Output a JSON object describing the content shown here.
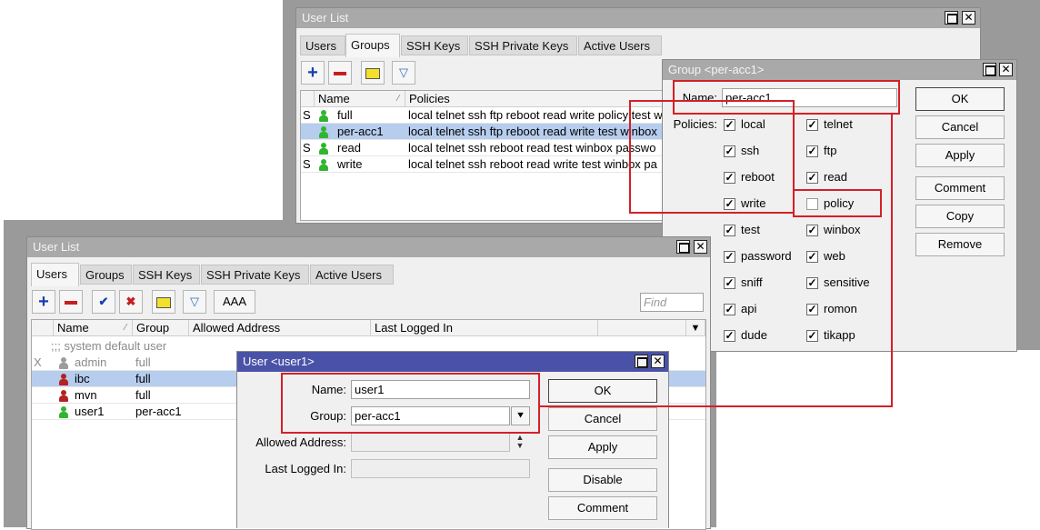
{
  "win_top": {
    "title": "User List",
    "tabs": [
      "Users",
      "Groups",
      "SSH Keys",
      "SSH Private Keys",
      "Active Users"
    ],
    "columns": {
      "name": "Name",
      "policies": "Policies"
    },
    "rows": [
      {
        "flag": "S",
        "name": "full",
        "policies": "local telnet ssh ftp reboot read write policy test w"
      },
      {
        "flag": "",
        "name": "per-acc1",
        "policies": "local telnet ssh ftp reboot read write test winbox"
      },
      {
        "flag": "S",
        "name": "read",
        "policies": "local telnet ssh reboot read test winbox passwo"
      },
      {
        "flag": "S",
        "name": "write",
        "policies": "local telnet ssh reboot read write test winbox pa"
      }
    ]
  },
  "group_dialog": {
    "title": "Group <per-acc1>",
    "name_label": "Name:",
    "name_value": "per-acc1",
    "policies_label": "Policies:",
    "policies": [
      {
        "label": "local",
        "checked": true
      },
      {
        "label": "telnet",
        "checked": true
      },
      {
        "label": "ssh",
        "checked": true
      },
      {
        "label": "ftp",
        "checked": true
      },
      {
        "label": "reboot",
        "checked": true
      },
      {
        "label": "read",
        "checked": true
      },
      {
        "label": "write",
        "checked": true
      },
      {
        "label": "policy",
        "checked": false
      },
      {
        "label": "test",
        "checked": true
      },
      {
        "label": "winbox",
        "checked": true
      },
      {
        "label": "password",
        "checked": true
      },
      {
        "label": "web",
        "checked": true
      },
      {
        "label": "sniff",
        "checked": true
      },
      {
        "label": "sensitive",
        "checked": true
      },
      {
        "label": "api",
        "checked": true
      },
      {
        "label": "romon",
        "checked": true
      },
      {
        "label": "dude",
        "checked": true
      },
      {
        "label": "tikapp",
        "checked": true
      }
    ],
    "buttons": [
      "OK",
      "Cancel",
      "Apply",
      "Comment",
      "Copy",
      "Remove"
    ]
  },
  "win_bottom": {
    "title": "User List",
    "tabs": [
      "Users",
      "Groups",
      "SSH Keys",
      "SSH Private Keys",
      "Active Users"
    ],
    "aaa_label": "AAA",
    "find_placeholder": "Find",
    "columns": {
      "name": "Name",
      "group": "Group",
      "allowed": "Allowed Address",
      "last": "Last Logged In"
    },
    "system_default": ";;; system default user",
    "rows": [
      {
        "flag": "X",
        "name": "admin",
        "group": "full",
        "icon": "gray"
      },
      {
        "flag": "",
        "name": "ibc",
        "group": "full",
        "icon": "red"
      },
      {
        "flag": "",
        "name": "mvn",
        "group": "full",
        "icon": "red"
      },
      {
        "flag": "",
        "name": "user1",
        "group": "per-acc1",
        "icon": "green"
      }
    ]
  },
  "user_dialog": {
    "title": "User <user1>",
    "name_label": "Name:",
    "name_value": "user1",
    "group_label": "Group:",
    "group_value": "per-acc1",
    "allowed_label": "Allowed Address:",
    "last_label": "Last Logged In:",
    "buttons": [
      "OK",
      "Cancel",
      "Apply",
      "Disable",
      "Comment"
    ]
  },
  "colors": {
    "highlight": "#d42028",
    "selected_row": "#b6cdee",
    "active_title": "#4a52a8"
  }
}
